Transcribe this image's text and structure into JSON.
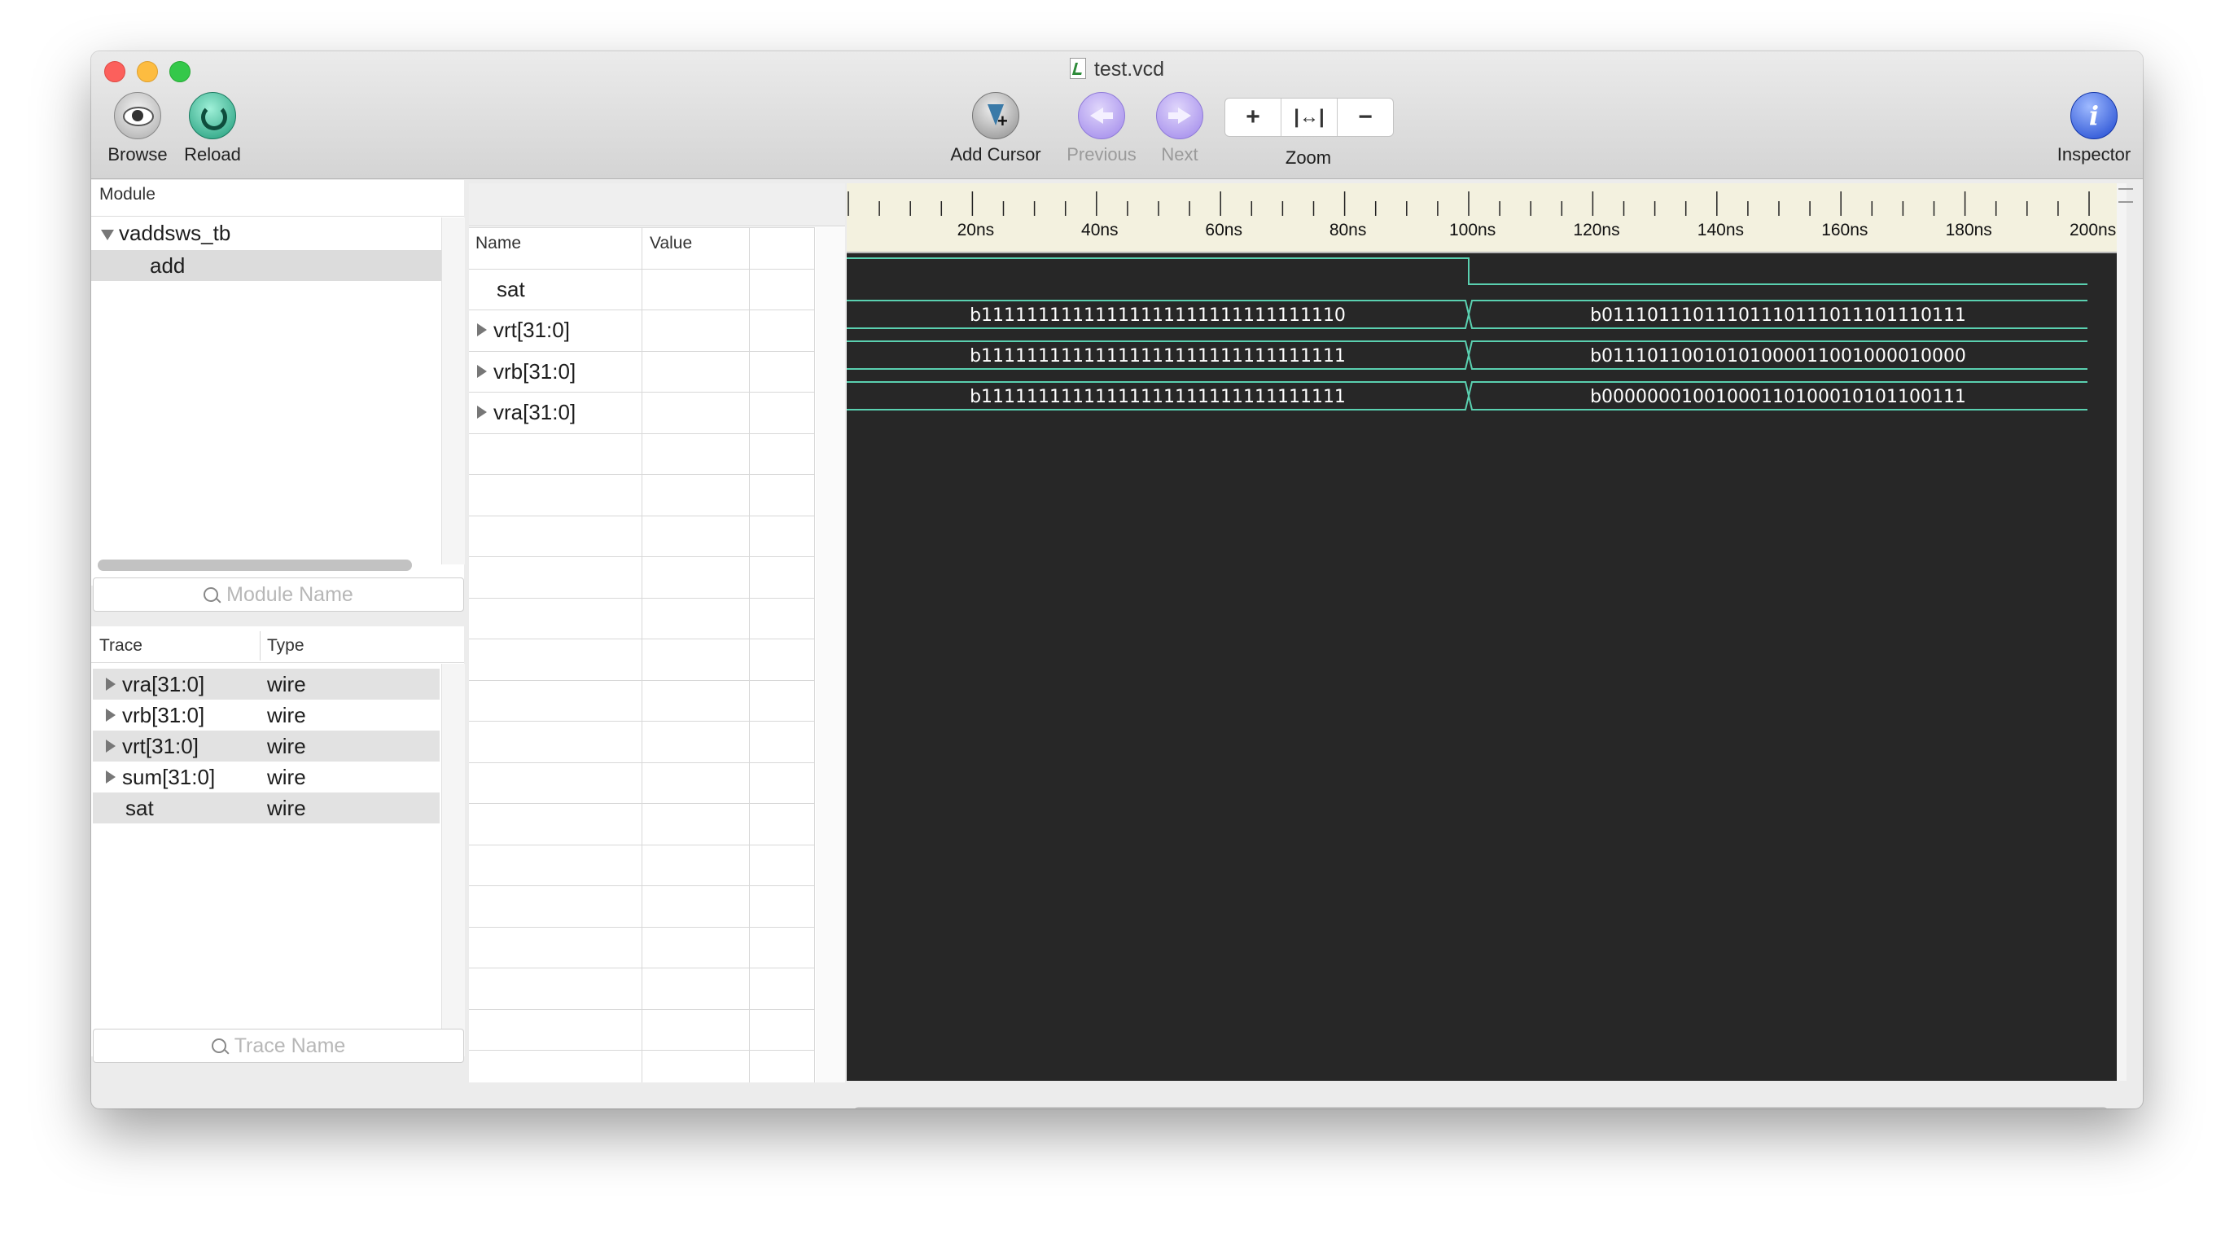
{
  "window": {
    "title": "test.vcd"
  },
  "toolbar": {
    "browse": "Browse",
    "reload": "Reload",
    "add_cursor": "Add Cursor",
    "previous": "Previous",
    "next": "Next",
    "zoom": "Zoom",
    "zoom_in_glyph": "+",
    "zoom_fit_glyph": "|↔|",
    "zoom_out_glyph": "−",
    "inspector": "Inspector",
    "icons": {
      "browse": "eye-icon",
      "reload": "reload-icon",
      "add_cursor": "add-cursor-icon",
      "previous": "previous-arrow-icon",
      "next": "next-arrow-icon",
      "inspector": "info-icon"
    }
  },
  "module_panel": {
    "header": "Module",
    "tree": [
      {
        "label": "vaddsws_tb",
        "expanded": true
      },
      {
        "label": "add",
        "selected": true
      }
    ],
    "search_placeholder": "Module Name"
  },
  "trace_panel": {
    "headers": {
      "trace": "Trace",
      "type": "Type"
    },
    "rows": [
      {
        "name": "vra[31:0]",
        "type": "wire",
        "expandable": true
      },
      {
        "name": "vrb[31:0]",
        "type": "wire",
        "expandable": true
      },
      {
        "name": "vrt[31:0]",
        "type": "wire",
        "expandable": true
      },
      {
        "name": "sum[31:0]",
        "type": "wire",
        "expandable": true
      },
      {
        "name": "sat",
        "type": "wire",
        "expandable": false
      }
    ],
    "search_placeholder": "Trace Name"
  },
  "signal_panel": {
    "headers": {
      "name": "Name",
      "value": "Value"
    },
    "rows": [
      {
        "name": "sat",
        "expandable": false
      },
      {
        "name": "vrt[31:0]",
        "expandable": true
      },
      {
        "name": "vrb[31:0]",
        "expandable": true
      },
      {
        "name": "vra[31:0]",
        "expandable": true
      }
    ]
  },
  "ruler": {
    "labels": [
      "20ns",
      "40ns",
      "60ns",
      "80ns",
      "100ns",
      "120ns",
      "140ns",
      "160ns",
      "180ns",
      "200ns"
    ]
  },
  "waves": [
    {
      "signal": "sat",
      "kind": "bit",
      "high_until_ns": 100
    },
    {
      "signal": "vrt[31:0]",
      "kind": "bus",
      "transition_ns": 100,
      "values": [
        "b11111111111111111111111111111110",
        "b01110111011101110111011101110111"
      ]
    },
    {
      "signal": "vrb[31:0]",
      "kind": "bus",
      "transition_ns": 100,
      "values": [
        "b11111111111111111111111111111111",
        "b01110110010101000011001000010000"
      ]
    },
    {
      "signal": "vra[31:0]",
      "kind": "bus",
      "transition_ns": 100,
      "values": [
        "b11111111111111111111111111111111",
        "b00000001001000110100010101100111"
      ]
    }
  ],
  "colors": {
    "wave": "#5ad0b0",
    "canvas_bg": "#272727",
    "ruler_bg": "#f3f1df"
  }
}
